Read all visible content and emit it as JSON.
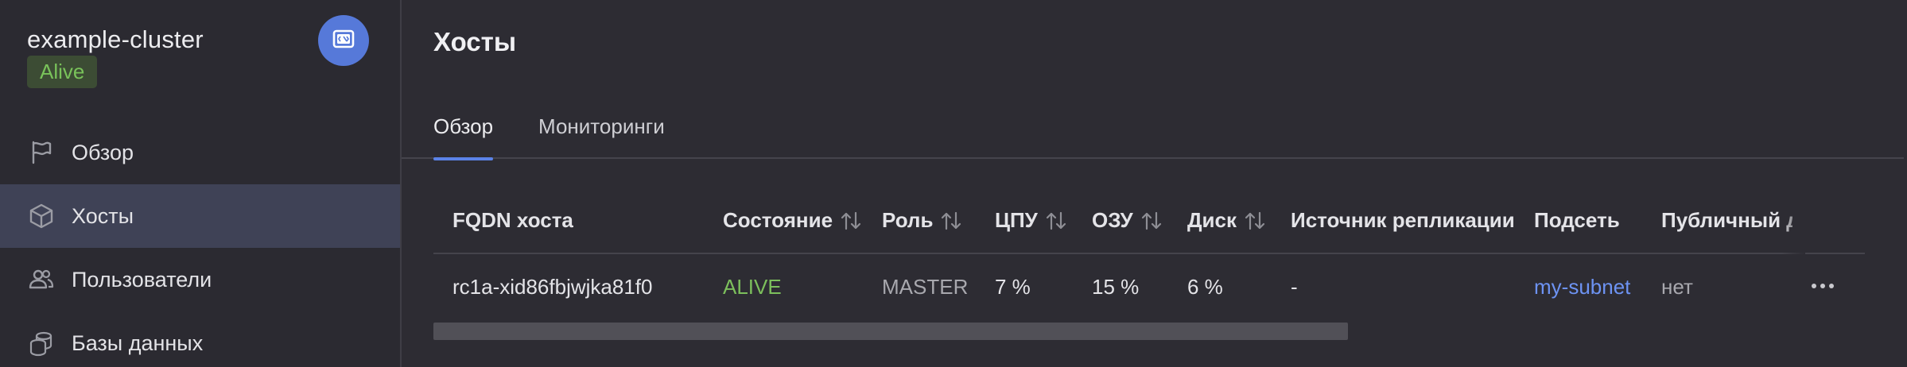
{
  "cluster": {
    "name": "example-cluster",
    "status": "Alive",
    "status_color": "#79c25a",
    "action_icon": "cluster-terminal-icon"
  },
  "sidebar": {
    "items": [
      {
        "label": "Обзор",
        "icon": "flag-icon",
        "active": false
      },
      {
        "label": "Хосты",
        "icon": "cube-icon",
        "active": true
      },
      {
        "label": "Пользователи",
        "icon": "users-icon",
        "active": false
      },
      {
        "label": "Базы данных",
        "icon": "database-icon",
        "active": false
      }
    ]
  },
  "page": {
    "title": "Хосты"
  },
  "tabs": [
    {
      "label": "Обзор",
      "active": true
    },
    {
      "label": "Мониторинги",
      "active": false
    }
  ],
  "table": {
    "columns": [
      "FQDN хоста",
      "Состояние",
      "Роль",
      "ЦПУ",
      "ОЗУ",
      "Диск",
      "Источник репликации",
      "Подсеть",
      "Публичный д"
    ],
    "rows": [
      {
        "fqdn": "rc1a-xid86fbjwjka81f0",
        "state": "ALIVE",
        "role": "MASTER",
        "cpu": "7 %",
        "ram": "15 %",
        "disk": "6 %",
        "replication_source": "-",
        "subnet": "my-subnet",
        "public": "нет"
      }
    ]
  },
  "colors": {
    "accent": "#5b83e8",
    "alive": "#7cbf5c",
    "link": "#6d93f3",
    "active_nav": "#3f4256"
  }
}
